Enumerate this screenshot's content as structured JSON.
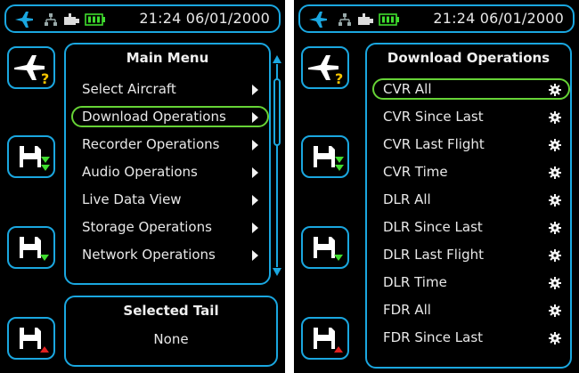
{
  "status_bar": {
    "time_date": "21:24 06/01/2000",
    "icons": [
      "airplane-icon",
      "network-icon",
      "usb-icon",
      "battery-icon"
    ],
    "battery_color": "#3fdc2e"
  },
  "side_buttons": [
    {
      "icon": "aircraft-help-icon"
    },
    {
      "icon": "floppy-download-icon"
    },
    {
      "icon": "floppy-save-icon"
    },
    {
      "icon": "floppy-upload-icon"
    }
  ],
  "main_menu": {
    "title": "Main Menu",
    "items": [
      {
        "label": "Select Aircraft"
      },
      {
        "label": "Download Operations"
      },
      {
        "label": "Recorder Operations"
      },
      {
        "label": "Audio Operations"
      },
      {
        "label": "Live Data View"
      },
      {
        "label": "Storage Operations"
      },
      {
        "label": "Network Operations"
      }
    ],
    "selected_label": "Download Operations"
  },
  "selected_tail": {
    "title": "Selected Tail",
    "value": "None"
  },
  "download_operations": {
    "title": "Download Operations",
    "items": [
      {
        "label": "CVR All"
      },
      {
        "label": "CVR Since Last"
      },
      {
        "label": "CVR Last Flight"
      },
      {
        "label": "CVR Time"
      },
      {
        "label": "DLR All"
      },
      {
        "label": "DLR Since Last"
      },
      {
        "label": "DLR Last Flight"
      },
      {
        "label": "DLR Time"
      },
      {
        "label": "FDR All"
      },
      {
        "label": "FDR Since Last"
      }
    ],
    "selected_label": "CVR All"
  },
  "colors": {
    "accent": "#1aa7e0",
    "selection": "#66d336",
    "alert": "#e02020",
    "background": "#000000"
  }
}
